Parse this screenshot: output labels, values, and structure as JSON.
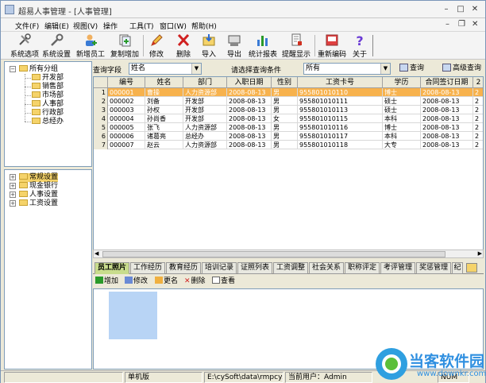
{
  "window": {
    "title": "超易人事管理 - [人事管理]"
  },
  "menu": [
    {
      "label": "文件(F)"
    },
    {
      "label": "编辑(E)"
    },
    {
      "label": "视图(V)"
    },
    {
      "label": "操作"
    },
    {
      "label": "工具(T)"
    },
    {
      "label": "窗口(W)"
    },
    {
      "label": "帮助(H)"
    }
  ],
  "toolbar": [
    {
      "label": "系统选项",
      "icon": "tools-icon"
    },
    {
      "label": "系统设置",
      "icon": "wrench-icon"
    },
    {
      "label": "新增员工",
      "icon": "add-user-icon"
    },
    {
      "label": "复制增加",
      "icon": "copy-add-icon"
    },
    {
      "label": "修改",
      "icon": "pencil-icon"
    },
    {
      "label": "删除",
      "icon": "delete-icon"
    },
    {
      "label": "导入",
      "icon": "import-icon"
    },
    {
      "label": "导出",
      "icon": "export-icon"
    },
    {
      "label": "统计报表",
      "icon": "bar-chart-icon"
    },
    {
      "label": "提醒显示",
      "icon": "reminder-icon"
    },
    {
      "label": "重新编码",
      "icon": "recode-icon"
    },
    {
      "label": "关于",
      "icon": "help-icon"
    }
  ],
  "org_tree": {
    "root": "所有分组",
    "children": [
      "开发部",
      "销售部",
      "市场部",
      "人事部",
      "行政部",
      "总经办"
    ]
  },
  "settings_tree": [
    {
      "label": "常规设置",
      "selected": true
    },
    {
      "label": "现金银行"
    },
    {
      "label": "人事设置"
    },
    {
      "label": "工资设置"
    }
  ],
  "query": {
    "field_label": "查询字段",
    "field_value": "姓名",
    "condition_label": "请选择查询条件",
    "condition_value": "所有",
    "search_btn": "查询",
    "advanced_btn": "高级查询"
  },
  "grid": {
    "columns": [
      "编号",
      "姓名",
      "部门",
      "入职日期",
      "性别",
      "工资卡号",
      "学历",
      "合同签订日期",
      "2"
    ],
    "rows": [
      {
        "idx": "1",
        "cells": [
          "000001",
          "曹操",
          "人力资源部",
          "2008-08-13",
          "男",
          "955801010110",
          "博士",
          "2008-08-13",
          "2"
        ]
      },
      {
        "idx": "2",
        "cells": [
          "000002",
          "刘备",
          "开发部",
          "2008-08-13",
          "男",
          "955801010111",
          "硕士",
          "2008-08-13",
          "2"
        ]
      },
      {
        "idx": "3",
        "cells": [
          "000003",
          "孙权",
          "开发部",
          "2008-08-13",
          "男",
          "955801010113",
          "硕士",
          "2008-08-13",
          "2"
        ]
      },
      {
        "idx": "4",
        "cells": [
          "000004",
          "孙尚香",
          "开发部",
          "2008-08-13",
          "女",
          "955801010115",
          "本科",
          "2008-08-13",
          "2"
        ]
      },
      {
        "idx": "5",
        "cells": [
          "000005",
          "张飞",
          "人力资源部",
          "2008-08-13",
          "男",
          "955801010116",
          "博士",
          "2008-08-13",
          "2"
        ]
      },
      {
        "idx": "6",
        "cells": [
          "000006",
          "诸葛亮",
          "总经办",
          "2008-08-13",
          "男",
          "955801010117",
          "本科",
          "2008-08-13",
          "2"
        ]
      },
      {
        "idx": "7",
        "cells": [
          "000007",
          "赵云",
          "人力资源部",
          "2008-08-13",
          "男",
          "955801010118",
          "大专",
          "2008-08-13",
          "2"
        ]
      }
    ]
  },
  "tabs": [
    {
      "label": "员工照片",
      "active": true
    },
    {
      "label": "工作经历"
    },
    {
      "label": "教育经历"
    },
    {
      "label": "培训记录"
    },
    {
      "label": "证照列表"
    },
    {
      "label": "工资调整"
    },
    {
      "label": "社会关系"
    },
    {
      "label": "职称评定"
    },
    {
      "label": "考评管理"
    },
    {
      "label": "奖惩管理"
    },
    {
      "label": "纪"
    }
  ],
  "photo_toolbar": [
    {
      "label": "增加",
      "icon": "add-icon"
    },
    {
      "label": "修改",
      "icon": "edit-icon"
    },
    {
      "label": "更名",
      "icon": "rename-icon"
    },
    {
      "label": "删除",
      "icon": "delete-icon"
    },
    {
      "label": "查看",
      "icon": "view-icon"
    }
  ],
  "status": {
    "mode": "单机版",
    "path": "E:\\cySoft\\data\\rmpcysc.sys",
    "user": "当前用户：Admin",
    "num": "NUM"
  },
  "watermark": {
    "title": "当客软件园",
    "url": "www.downkr.com"
  }
}
